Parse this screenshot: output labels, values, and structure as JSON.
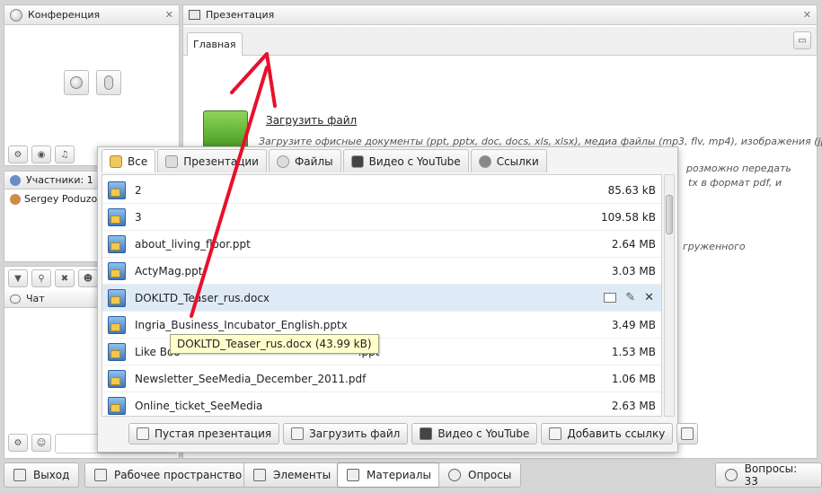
{
  "left_panel": {
    "conference_title": "Конференция",
    "participants_title": "Участники: 1",
    "participant_name": "Sergey Poduzov",
    "chat_title": "Чат"
  },
  "presentation_panel": {
    "title": "Презентация",
    "tab_main": "Главная",
    "upload_link": "Загрузить файл",
    "desc_line1": "Загрузите офисные документы (ppt, pptx, doc, docs, xls, xlsx), медиа файлы (mp3, flv, mp4), изображения (jpg,",
    "desc_line2": "розможно передать",
    "desc_line3": "tx в формат pdf, и",
    "desc_line4": "груженного"
  },
  "library": {
    "tabs": [
      {
        "label": "Все",
        "icon": "folder-icon"
      },
      {
        "label": "Презентации",
        "icon": "presentation-icon"
      },
      {
        "label": "Файлы",
        "icon": "disc-icon"
      },
      {
        "label": "Видео с YouTube",
        "icon": "youtube-icon"
      },
      {
        "label": "Ссылки",
        "icon": "globe-icon"
      }
    ],
    "files": [
      {
        "name": "2",
        "size": "85.63 kB"
      },
      {
        "name": "3",
        "size": "109.58 kB"
      },
      {
        "name": "about_living_floor.ppt",
        "size": "2.64 MB"
      },
      {
        "name": "ActyMag.ppt",
        "size": "3.03 MB"
      },
      {
        "name": "DOKLTD_Teaser_rus.docx",
        "size": ""
      },
      {
        "name": "Ingria_Business_Incubator_English.pptx",
        "size": "3.49 MB"
      },
      {
        "name": "Like Boo",
        "name_tail": ".ppt",
        "size": "1.53 MB"
      },
      {
        "name": "Newsletter_SeeMedia_December_2011.pdf",
        "size": "1.06 MB"
      },
      {
        "name": "Online_ticket_SeeMedia",
        "size": "2.63 MB"
      }
    ],
    "tooltip": "DOKLTD_Teaser_rus.docx (43.99 kB)",
    "actions": {
      "empty_presentation": "Пустая презентация",
      "upload_file": "Загрузить файл",
      "youtube_video": "Видео с YouTube",
      "add_link": "Добавить ссылку"
    }
  },
  "bottom_bar": {
    "exit": "Выход",
    "workspace": "Рабочее пространство",
    "elements": "Элементы",
    "materials": "Материалы",
    "polls": "Опросы",
    "questions": "Вопросы: 33"
  },
  "colors": {
    "annotation_arrow": "#e8102a",
    "selected_row": "#dfeaf7",
    "tooltip_bg": "#ffffcc"
  }
}
